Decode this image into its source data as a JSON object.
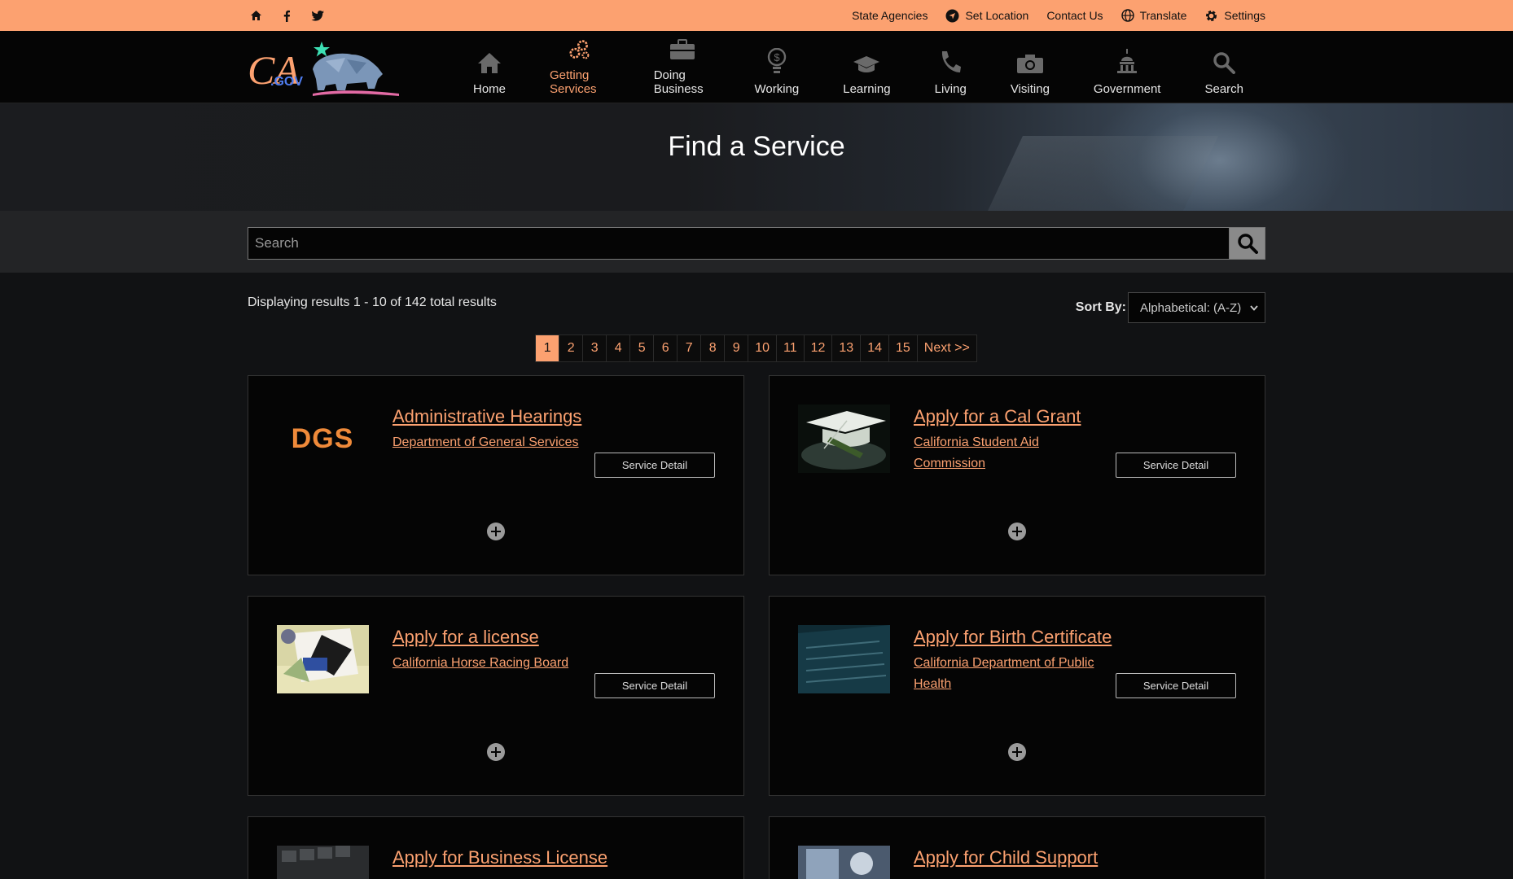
{
  "utility": {
    "links": {
      "state_agencies": "State Agencies",
      "set_location": "Set Location",
      "contact_us": "Contact Us",
      "translate": "Translate",
      "settings": "Settings"
    }
  },
  "logo": {
    "text": "CA",
    "sub": ".GOV"
  },
  "nav": [
    {
      "label": "Home",
      "icon": "home-icon"
    },
    {
      "label": "Getting Services",
      "icon": "gears-icon",
      "active": true
    },
    {
      "label": "Doing Business",
      "icon": "briefcase-icon"
    },
    {
      "label": "Working",
      "icon": "lightbulb-icon"
    },
    {
      "label": "Learning",
      "icon": "graduation-cap-icon"
    },
    {
      "label": "Living",
      "icon": "phone-icon"
    },
    {
      "label": "Visiting",
      "icon": "camera-icon"
    },
    {
      "label": "Government",
      "icon": "capitol-icon"
    },
    {
      "label": "Search",
      "icon": "search-icon"
    }
  ],
  "hero": {
    "title": "Find a Service"
  },
  "search": {
    "placeholder": "Search"
  },
  "results": {
    "count_text": "Displaying results 1 - 10 of 142 total results",
    "sort_label": "Sort By:",
    "sort_value": "Alphabetical: (A-Z)"
  },
  "pager": {
    "pages": [
      "1",
      "2",
      "3",
      "4",
      "5",
      "6",
      "7",
      "8",
      "9",
      "10",
      "11",
      "12",
      "13",
      "14",
      "15"
    ],
    "current": "1",
    "next": "Next >>"
  },
  "cards": [
    {
      "title": "Administrative Hearings",
      "agency": "Department of General Services",
      "button": "Service Detail",
      "thumb_text": "DGS"
    },
    {
      "title": "Apply for a Cal Grant",
      "agency": "California Student Aid Commission",
      "button": "Service Detail"
    },
    {
      "title": "Apply for a license",
      "agency": "California Horse Racing Board",
      "button": "Service Detail"
    },
    {
      "title": "Apply for Birth Certificate",
      "agency": "California Department of Public Health",
      "button": "Service Detail"
    },
    {
      "title": "Apply for Business License"
    },
    {
      "title": "Apply for Child Support"
    }
  ],
  "colors": {
    "accent": "#fca170",
    "background": "#111214",
    "card": "#050505"
  }
}
